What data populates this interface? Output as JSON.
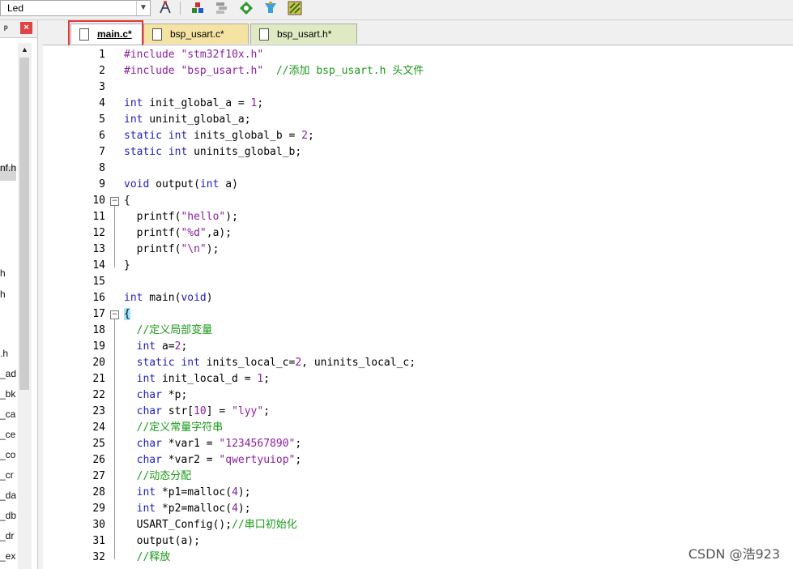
{
  "toolbar": {
    "target_value": "Led",
    "icons": [
      "options-icon",
      "load-icon",
      "pack-icon",
      "build-icon",
      "debug-icon",
      "flash-icon"
    ]
  },
  "left_panel": {
    "pin": "ᵖ",
    "close": "×",
    "items": [
      "nf.h",
      "h",
      "h",
      ".h",
      "_ad",
      "_bk",
      "_ca",
      "_ce",
      "_co",
      "_cr",
      "_da",
      "_db",
      "_dr",
      "_ex"
    ]
  },
  "tabs": [
    {
      "label": "main.c*",
      "active": true
    },
    {
      "label": "bsp_usart.c*",
      "active": false
    },
    {
      "label": "bsp_usart.h*",
      "active": false
    }
  ],
  "code_lines": [
    {
      "n": "1",
      "tokens": [
        [
          "kw2",
          "#include "
        ],
        [
          "str",
          "\"stm32f10x.h\""
        ]
      ]
    },
    {
      "n": "2",
      "tokens": [
        [
          "kw2",
          "#include "
        ],
        [
          "str",
          "\"bsp_usart.h\""
        ],
        [
          "t",
          "  "
        ],
        [
          "cm",
          "//添加 bsp_usart.h 头文件"
        ]
      ]
    },
    {
      "n": "3",
      "tokens": []
    },
    {
      "n": "4",
      "tokens": [
        [
          "kw",
          "int"
        ],
        [
          "t",
          " init_global_a = "
        ],
        [
          "num",
          "1"
        ],
        [
          "t",
          ";"
        ]
      ]
    },
    {
      "n": "5",
      "tokens": [
        [
          "kw",
          "int"
        ],
        [
          "t",
          " uninit_global_a;"
        ]
      ]
    },
    {
      "n": "6",
      "tokens": [
        [
          "kw",
          "static int"
        ],
        [
          "t",
          " inits_global_b = "
        ],
        [
          "num",
          "2"
        ],
        [
          "t",
          ";"
        ]
      ]
    },
    {
      "n": "7",
      "tokens": [
        [
          "kw",
          "static int"
        ],
        [
          "t",
          " uninits_global_b;"
        ]
      ]
    },
    {
      "n": "8",
      "tokens": []
    },
    {
      "n": "9",
      "tokens": [
        [
          "kw",
          "void"
        ],
        [
          "t",
          " output("
        ],
        [
          "kw",
          "int"
        ],
        [
          "t",
          " a)"
        ]
      ]
    },
    {
      "n": "10",
      "tokens": [
        [
          "t",
          "{"
        ]
      ],
      "fold": "−"
    },
    {
      "n": "11",
      "tokens": [
        [
          "t",
          "  printf("
        ],
        [
          "str",
          "\"hello\""
        ],
        [
          "t",
          ");"
        ]
      ]
    },
    {
      "n": "12",
      "tokens": [
        [
          "t",
          "  printf("
        ],
        [
          "str",
          "\"%d\""
        ],
        [
          "t",
          ",a);"
        ]
      ]
    },
    {
      "n": "13",
      "tokens": [
        [
          "t",
          "  printf("
        ],
        [
          "str",
          "\"\\n\""
        ],
        [
          "t",
          ");"
        ]
      ]
    },
    {
      "n": "14",
      "tokens": [
        [
          "t",
          "}"
        ]
      ]
    },
    {
      "n": "15",
      "tokens": []
    },
    {
      "n": "16",
      "tokens": [
        [
          "kw",
          "int"
        ],
        [
          "t",
          " main("
        ],
        [
          "kw",
          "void"
        ],
        [
          "t",
          ")"
        ]
      ]
    },
    {
      "n": "17",
      "tokens": [
        [
          "brace",
          "{"
        ]
      ],
      "fold": "−"
    },
    {
      "n": "18",
      "tokens": [
        [
          "t",
          "  "
        ],
        [
          "cm",
          "//定义局部变量"
        ]
      ]
    },
    {
      "n": "19",
      "tokens": [
        [
          "t",
          "  "
        ],
        [
          "kw",
          "int"
        ],
        [
          "t",
          " a="
        ],
        [
          "num",
          "2"
        ],
        [
          "t",
          ";"
        ]
      ]
    },
    {
      "n": "20",
      "tokens": [
        [
          "t",
          "  "
        ],
        [
          "kw",
          "static int"
        ],
        [
          "t",
          " inits_local_c="
        ],
        [
          "num",
          "2"
        ],
        [
          "t",
          ", uninits_local_c;"
        ]
      ]
    },
    {
      "n": "21",
      "tokens": [
        [
          "t",
          "  "
        ],
        [
          "kw",
          "int"
        ],
        [
          "t",
          " init_local_d = "
        ],
        [
          "num",
          "1"
        ],
        [
          "t",
          ";"
        ]
      ]
    },
    {
      "n": "22",
      "tokens": [
        [
          "t",
          "  "
        ],
        [
          "kw",
          "char"
        ],
        [
          "t",
          " *p;"
        ]
      ]
    },
    {
      "n": "23",
      "tokens": [
        [
          "t",
          "  "
        ],
        [
          "kw",
          "char"
        ],
        [
          "t",
          " str["
        ],
        [
          "num",
          "10"
        ],
        [
          "t",
          "] = "
        ],
        [
          "str",
          "\"lyy\""
        ],
        [
          "t",
          ";"
        ]
      ]
    },
    {
      "n": "24",
      "tokens": [
        [
          "t",
          "  "
        ],
        [
          "cm",
          "//定义常量字符串"
        ]
      ]
    },
    {
      "n": "25",
      "tokens": [
        [
          "t",
          "  "
        ],
        [
          "kw",
          "char"
        ],
        [
          "t",
          " *var1 = "
        ],
        [
          "str",
          "\"1234567890\""
        ],
        [
          "t",
          ";"
        ]
      ]
    },
    {
      "n": "26",
      "tokens": [
        [
          "t",
          "  "
        ],
        [
          "kw",
          "char"
        ],
        [
          "t",
          " *var2 = "
        ],
        [
          "str",
          "\"qwertyuiop\""
        ],
        [
          "t",
          ";"
        ]
      ]
    },
    {
      "n": "27",
      "tokens": [
        [
          "t",
          "  "
        ],
        [
          "cm",
          "//动态分配"
        ]
      ]
    },
    {
      "n": "28",
      "tokens": [
        [
          "t",
          "  "
        ],
        [
          "kw",
          "int"
        ],
        [
          "t",
          " *p1=malloc("
        ],
        [
          "num",
          "4"
        ],
        [
          "t",
          ");"
        ]
      ]
    },
    {
      "n": "29",
      "tokens": [
        [
          "t",
          "  "
        ],
        [
          "kw",
          "int"
        ],
        [
          "t",
          " *p2=malloc("
        ],
        [
          "num",
          "4"
        ],
        [
          "t",
          ");"
        ]
      ]
    },
    {
      "n": "30",
      "tokens": [
        [
          "t",
          "  USART_Config();"
        ],
        [
          "cm",
          "//串口初始化"
        ]
      ]
    },
    {
      "n": "31",
      "tokens": [
        [
          "t",
          "  output(a);"
        ]
      ]
    },
    {
      "n": "32",
      "tokens": [
        [
          "t",
          "  "
        ],
        [
          "cm",
          "//释放"
        ]
      ]
    }
  ],
  "colors": {
    "keyword": "#1e1ebe",
    "string": "#8c1ea0",
    "comment": "#1a9a1a",
    "highlight": "#e53935"
  },
  "watermark": "CSDN @浩923"
}
